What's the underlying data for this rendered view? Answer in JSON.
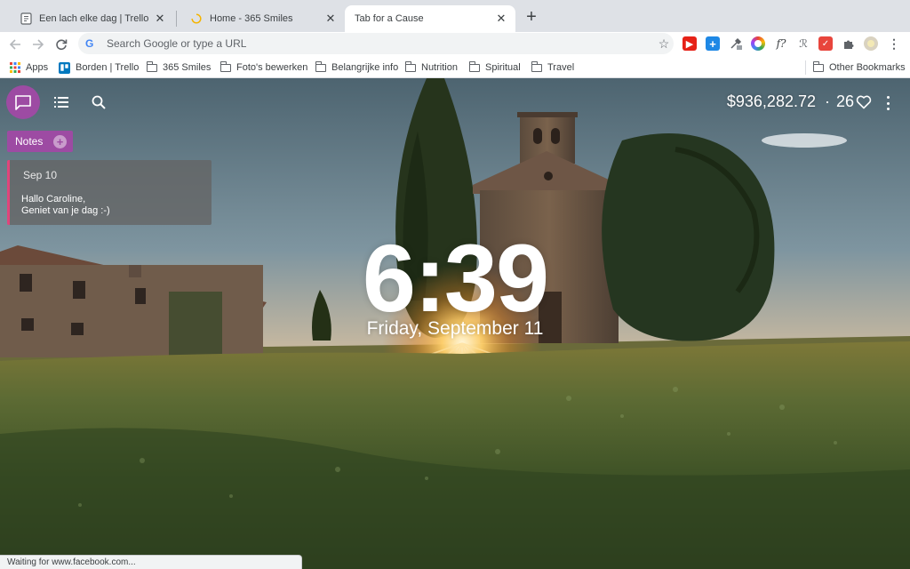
{
  "tabs": [
    {
      "title": "Een lach elke dag | Trello",
      "active": false
    },
    {
      "title": "Home - 365 Smiles",
      "active": false
    },
    {
      "title": "Tab for a Cause",
      "active": true
    }
  ],
  "toolbar": {
    "omnibox_placeholder": "Search Google or type a URL"
  },
  "bookmarks": {
    "items": [
      {
        "label": "Apps",
        "icon": "apps-grid-icon"
      },
      {
        "label": "Borden | Trello",
        "icon": "trello-icon"
      },
      {
        "label": "365 Smiles",
        "icon": "folder-icon"
      },
      {
        "label": "Foto's bewerken",
        "icon": "folder-icon"
      },
      {
        "label": "Belangrijke info",
        "icon": "folder-icon"
      },
      {
        "label": "Nutrition",
        "icon": "folder-icon"
      },
      {
        "label": "Spiritual",
        "icon": "folder-icon"
      },
      {
        "label": "Travel",
        "icon": "folder-icon"
      }
    ],
    "other": "Other Bookmarks"
  },
  "page": {
    "money_raised": "$936,282.72",
    "separator": "·",
    "hearts": "26",
    "notes_label": "Notes",
    "note": {
      "date": "Sep 10",
      "line1": "Hallo Caroline,",
      "line2": "Geniet van je dag :-)"
    },
    "time": "6:39",
    "date": "Friday, September 11"
  },
  "status_bar": "Waiting for www.facebook.com...",
  "colors": {
    "accent_purple": "#9d4ba3",
    "note_border": "#e0457b"
  }
}
